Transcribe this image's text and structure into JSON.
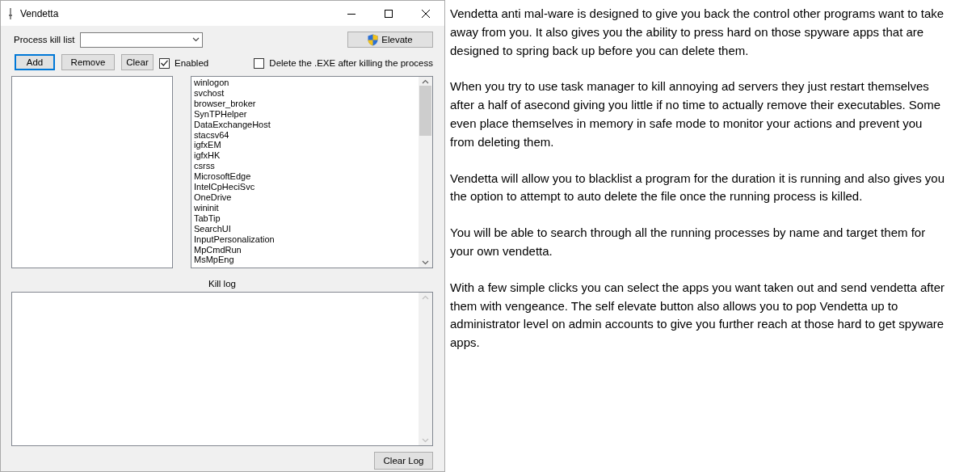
{
  "window": {
    "title": "Vendetta"
  },
  "kill_list": {
    "label": "Process kill list"
  },
  "elevate_button": {
    "label": "Elevate"
  },
  "buttons": [
    {
      "label": "Add",
      "focused": true
    },
    {
      "label": "Remove",
      "focused": false
    },
    {
      "label": "Clear",
      "focused": false
    }
  ],
  "checkboxes": [
    {
      "label": "Enabled",
      "checked": true
    },
    {
      "label": "Delete the .EXE after killing the process",
      "checked": false
    }
  ],
  "processes": [
    "winlogon",
    "svchost",
    "browser_broker",
    "SynTPHelper",
    "DataExchangeHost",
    "stacsv64",
    "igfxEM",
    "igfxHK",
    "csrss",
    "MicrosoftEdge",
    "IntelCpHeciSvc",
    "OneDrive",
    "wininit",
    "TabTip",
    "SearchUI",
    "InputPersonalization",
    "MpCmdRun",
    "MsMpEng"
  ],
  "kill_log": {
    "label": "Kill log"
  },
  "clear_log_button": {
    "label": "Clear Log"
  },
  "description": [
    "Vendetta anti mal-ware is designed to give you back the control other programs want to take away from you. It also gives you the ability to press hard on those spyware apps that are designed to spring back up before you can delete them.",
    "When you try to use task manager to kill annoying ad servers they just restart themselves after a half of asecond giving you little if no time to actually remove their executables. Some even place themselves in memory in safe mode to monitor your actions and prevent you from deleting them.",
    "Vendetta will allow you to blacklist a program for the duration it is running and also gives you the option to attempt to auto delete the file once the running process is killed.",
    "You will be able to search through all the running processes by name and target them for your own vendetta.",
    "With a few simple clicks you can select the apps you want taken out and send vendetta after them with vengeance. The self elevate button also allows you to pop Vendetta up to administrator level on admin accounts to give you further reach at those hard to get spyware apps."
  ]
}
